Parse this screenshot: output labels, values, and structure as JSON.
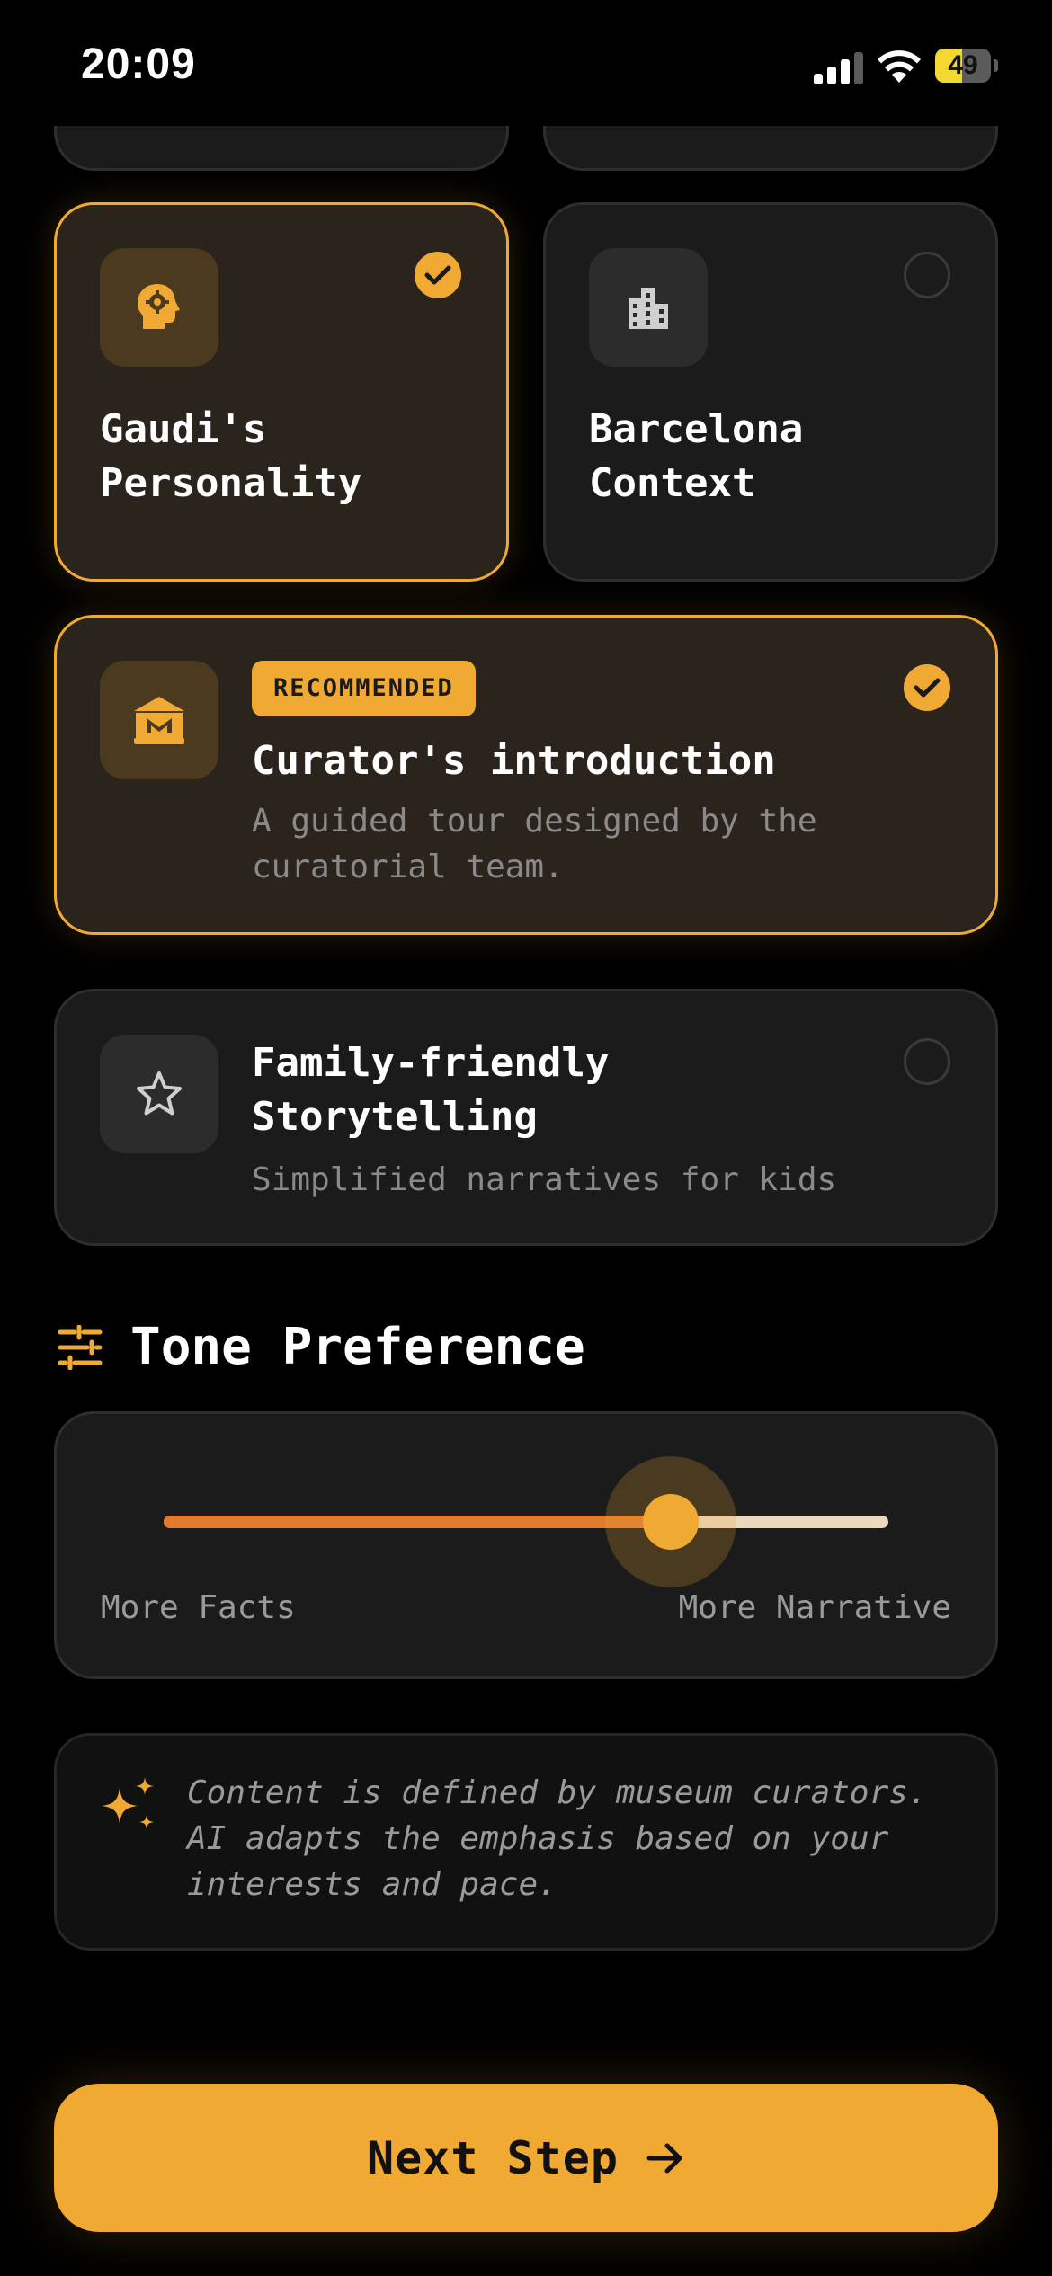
{
  "status": {
    "time": "20:09",
    "battery": "49",
    "battery_level": 0.49
  },
  "cards": {
    "gaudi": {
      "title": "Gaudi's Personality",
      "selected": true,
      "icon": "head-gear-icon"
    },
    "barcelona": {
      "title": "Barcelona Context",
      "selected": false,
      "icon": "building-icon"
    },
    "curator": {
      "badge": "RECOMMENDED",
      "title": "Curator's introduction",
      "description": "A guided tour designed by the curatorial team.",
      "selected": true,
      "icon": "museum-icon"
    },
    "family": {
      "title": "Family-friendly Storytelling",
      "description": "Simplified narratives for kids",
      "selected": false,
      "icon": "star-icon"
    }
  },
  "tone": {
    "title": "Tone Preference",
    "icon": "sliders-icon",
    "left_label": "More Facts",
    "right_label": "More Narrative",
    "value": 0.7
  },
  "info": {
    "text": "Content is defined by museum curators. AI adapts the emphasis based on your interests and pace.",
    "icon": "sparkle-icon"
  },
  "next": {
    "label": "Next Step",
    "icon": "arrow-right-icon"
  },
  "colors": {
    "accent": "#f0a932",
    "slider_fill": "#e07a2e",
    "background": "#000000"
  }
}
